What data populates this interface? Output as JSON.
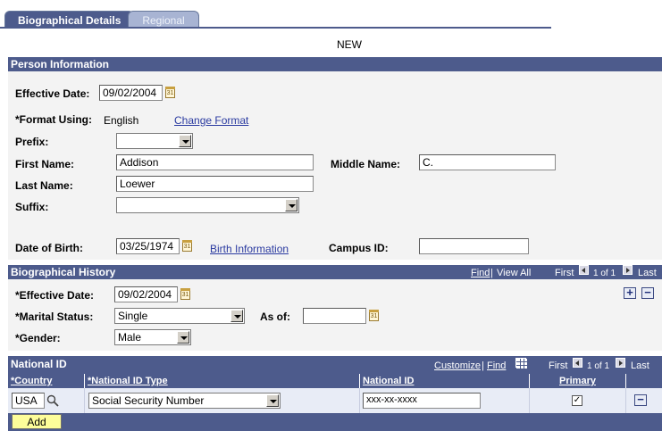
{
  "tabs": [
    {
      "label": "Biographical Details"
    },
    {
      "label": "Regional"
    }
  ],
  "status": "NEW",
  "person": {
    "section_title": "Person Information",
    "effective_date_label": "Effective Date:",
    "effective_date": "09/02/2004",
    "format_using_label": "*Format Using:",
    "format_using": "English",
    "change_format_link": "Change Format",
    "prefix_label": "Prefix:",
    "prefix": "",
    "first_name_label": "First Name:",
    "first_name": "Addison",
    "middle_name_label": "Middle Name:",
    "middle_name": "C.",
    "last_name_label": "Last Name:",
    "last_name": "Loewer",
    "suffix_label": "Suffix:",
    "suffix": "",
    "dob_label": "Date of Birth:",
    "dob": "03/25/1974",
    "birth_info_link": "Birth Information",
    "campus_id_label": "Campus ID:",
    "campus_id": ""
  },
  "bio_history": {
    "section_title": "Biographical History",
    "find": "Find",
    "view_all": "View All",
    "first": "First",
    "range": "1 of 1",
    "last": "Last",
    "effective_date_label": "*Effective Date:",
    "effective_date": "09/02/2004",
    "marital_status_label": "*Marital Status:",
    "marital_status": "Single",
    "as_of_label": "As of:",
    "as_of": "",
    "gender_label": "*Gender:",
    "gender": "Male",
    "add_row": "+",
    "delete_row": "−"
  },
  "national_id": {
    "section_title": "National ID",
    "customize": "Customize",
    "find": "Find",
    "first": "First",
    "range": "1 of 1",
    "last": "Last",
    "columns": [
      "*Country",
      "*National ID Type",
      "National ID",
      "Primary"
    ],
    "rows": [
      {
        "country": "USA",
        "type": "Social Security Number",
        "national_id": "xxx-xx-xxxx",
        "primary": "✓"
      }
    ],
    "delete_row": "−",
    "add_button": "Add"
  }
}
